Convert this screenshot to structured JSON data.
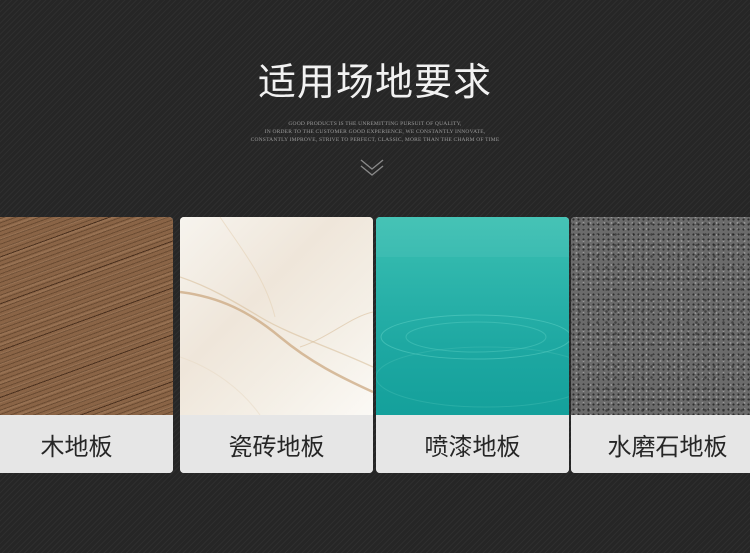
{
  "header": {
    "title": "适用场地要求",
    "subtitle_lines": [
      "GOOD PRODUCTS IS THE UNREMITTING PURSUIT OF QUALITY,",
      "IN ORDER TO THE CUSTOMER GOOD EXPERIENCE, WE CONSTANTLY INNOVATE,",
      "CONSTANTLY IMPROVE, STRIVE TO PERFECT, CLASSIC, MORE THAN THE CHARM OF TIME"
    ],
    "scroll_icon": "double-chevron-down-icon"
  },
  "cards": [
    {
      "label": "木地板",
      "texture": "wood"
    },
    {
      "label": "瓷砖地板",
      "texture": "marble"
    },
    {
      "label": "喷漆地板",
      "texture": "epoxy"
    },
    {
      "label": "水磨石地板",
      "texture": "terrazzo"
    }
  ],
  "colors": {
    "background": "#262626",
    "title": "#f2f2f2",
    "label_bg": "#e6e6e6",
    "label_text": "#262626"
  }
}
